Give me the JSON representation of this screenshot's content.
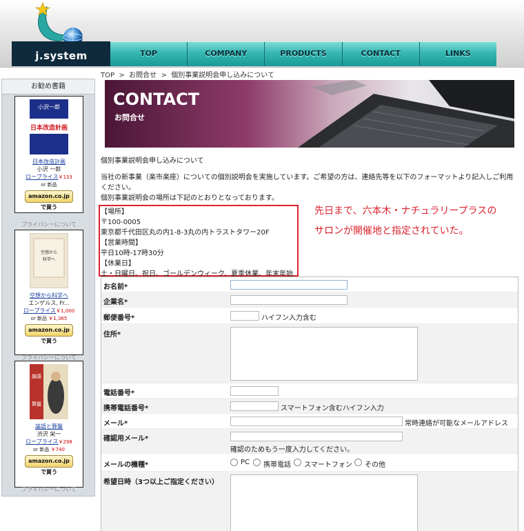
{
  "header": {
    "logo_text": "j.system",
    "nav": [
      "TOP",
      "COMPANY",
      "PRODUCTS",
      "CONTACT",
      "LINKS"
    ]
  },
  "breadcrumb": {
    "home": "TOP",
    "sep": ">",
    "inquiry": "お問合せ",
    "current": "個別事業説明会申し込みについて"
  },
  "sidebar": {
    "title": "お勧め書籍",
    "privacy": "プライバシーについて",
    "books": [
      {
        "title": "日本改造計画",
        "author": "小沢 一郎",
        "price_label": "ロープライス",
        "price": "￥133",
        "new_label": "or 新品",
        "new_price": "",
        "button": "amazon.co.jp で買う",
        "cover_text": "小沢一郎 日本改造計画"
      },
      {
        "title": "空想から科学へ",
        "author": "エンゲルス, Fr...",
        "price_label": "ロープライス",
        "price": "￥1,000",
        "new_label": "or 新品",
        "new_price": "￥1,365",
        "button": "amazon.co.jp で買う",
        "cover_text": "空想から科学へ"
      },
      {
        "title": "論語と算盤",
        "author": "渋沢 栄一",
        "price_label": "ロープライス",
        "price": "￥298",
        "new_label": "or 新品",
        "new_price": "￥740",
        "button": "amazon.co.jp で買う",
        "cover_text": "渋沢栄一 論語と算盤"
      }
    ]
  },
  "banner": {
    "title": "CONTACT",
    "subtitle": "お問合せ"
  },
  "intro": {
    "heading": "個別事業説明会申し込みについて",
    "p1": "当社の新事業（楽市楽座）についての個別説明会を実施しています。ご希望の方は、連絡先等を以下のフォーマットより記入しご利用ください。",
    "p2": "個別事業説明会の場所は下記のとおりとなっております。"
  },
  "info": {
    "place_label": "【場所】",
    "postal": "〒100-0005",
    "address": "東京都千代田区丸の内1-8-3丸の内トラストタワー20F",
    "hours_label": "【営業時間】",
    "hours": "平日10時-17時30分",
    "holiday_label": "【休業日】",
    "holidays": "土・日曜日、祝日、ゴールデンウィーク、夏季休業、年末年始"
  },
  "annotation": {
    "line1": "先日まで、六本木・ナチュラリープラスの",
    "line2": "サロンが開催地と指定されていた。"
  },
  "form": {
    "name": "お名前*",
    "company": "企業名*",
    "zip": "郵便番号*",
    "zip_hint": "ハイフン入力含む",
    "address": "住所*",
    "phone": "電話番号*",
    "mobile": "携帯電話番号*",
    "mobile_hint": "スマートフォン含むハイフン入力",
    "email": "メール*",
    "email_hint": "常時連絡が可能なメールアドレス",
    "email_confirm": "確認用メール*",
    "email_confirm_hint": "確認のためもう一度入力してください。",
    "device": "メールの機種*",
    "device_options": [
      "PC",
      "携帯電話",
      "スマートフォン",
      "その他"
    ],
    "dates": "希望日時（3つ以上ご指定ください）"
  },
  "colors": {
    "nav": "#35b7b2",
    "annotation": "#d9232d",
    "link": "#1a3fa0"
  }
}
